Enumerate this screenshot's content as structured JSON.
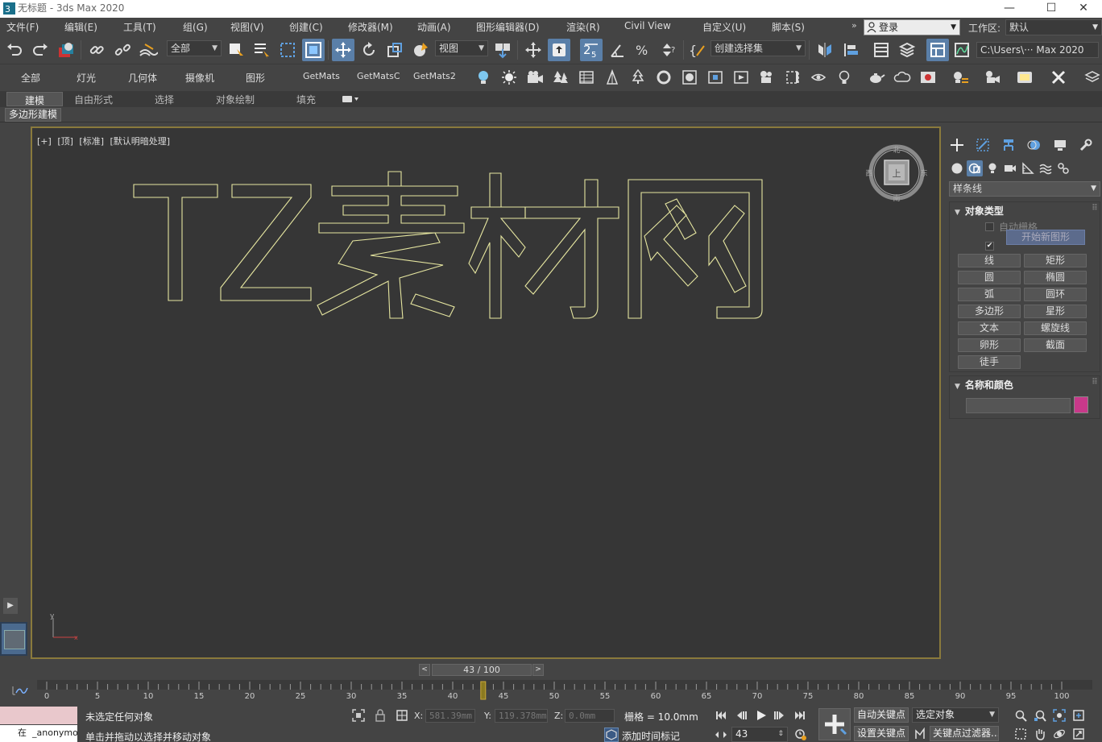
{
  "window": {
    "title": "无标题 - 3ds Max 2020",
    "minimize": "—",
    "maximize": "☐",
    "close": "✕"
  },
  "menu": {
    "items": [
      "文件(F)",
      "编辑(E)",
      "工具(T)",
      "组(G)",
      "视图(V)",
      "创建(C)",
      "修改器(M)",
      "动画(A)",
      "图形编辑器(D)",
      "渲染(R)",
      "Civil View",
      "自定义(U)",
      "脚本(S)"
    ],
    "more": "»"
  },
  "account": {
    "login_label": "登录",
    "workspace_label": "工作区:",
    "workspace_value": "默认"
  },
  "toolbar": {
    "selection_filter": "全部",
    "ref_coord": "视图",
    "named_selection": "创建选择集",
    "project_path": "C:\\Users\\··· Max 2020"
  },
  "shelf": {
    "tabs": [
      "全部",
      "灯光",
      "几何体",
      "摄像机",
      "图形"
    ],
    "scripts": [
      "GetMats",
      "GetMatsC",
      "GetMats2"
    ]
  },
  "ribbon": {
    "tabs": [
      "建模",
      "自由形式",
      "选择",
      "对象绘制",
      "填充"
    ],
    "subpanel": "多边形建模"
  },
  "viewport": {
    "label_parts": [
      "[+]",
      "[顶]",
      "[标准]",
      "[默认明暗处理]"
    ],
    "viewcube": {
      "north": "北",
      "south": "南",
      "east": "东",
      "west": "西",
      "face": "上"
    },
    "axis_y": "y"
  },
  "command_panel": {
    "category": "样条线",
    "object_type": {
      "title": "对象类型",
      "auto_grid": "自动栅格",
      "start_new_shape": "开始新图形",
      "buttons": [
        "线",
        "矩形",
        "圆",
        "椭圆",
        "弧",
        "圆环",
        "多边形",
        "星形",
        "文本",
        "螺旋线",
        "卵形",
        "截面",
        "徒手"
      ]
    },
    "name_color": {
      "title": "名称和颜色",
      "color": "#c8398a"
    }
  },
  "timeline": {
    "frame_display": "43 / 100",
    "current_frame": 43,
    "start": 0,
    "end": 100,
    "prev": "<",
    "next": ">"
  },
  "status": {
    "selection": "未选定任何对象",
    "prompt": "单击并拖动以选择并移动对象",
    "maxscript": "_anonymou",
    "maxscript_prefix": "在",
    "x_label": "X:",
    "x_value": "581.39mm",
    "y_label": "Y:",
    "y_value": "119.378mm",
    "z_label": "Z:",
    "z_value": "0.0mm",
    "grid": "栅格 = 10.0mm",
    "add_time_tag": "添加时间标记",
    "auto_key": "自动关键点",
    "set_key": "设置关键点",
    "selected_object": "选定对象",
    "key_filters": "关键点过滤器...",
    "frame_spinner": "43"
  }
}
